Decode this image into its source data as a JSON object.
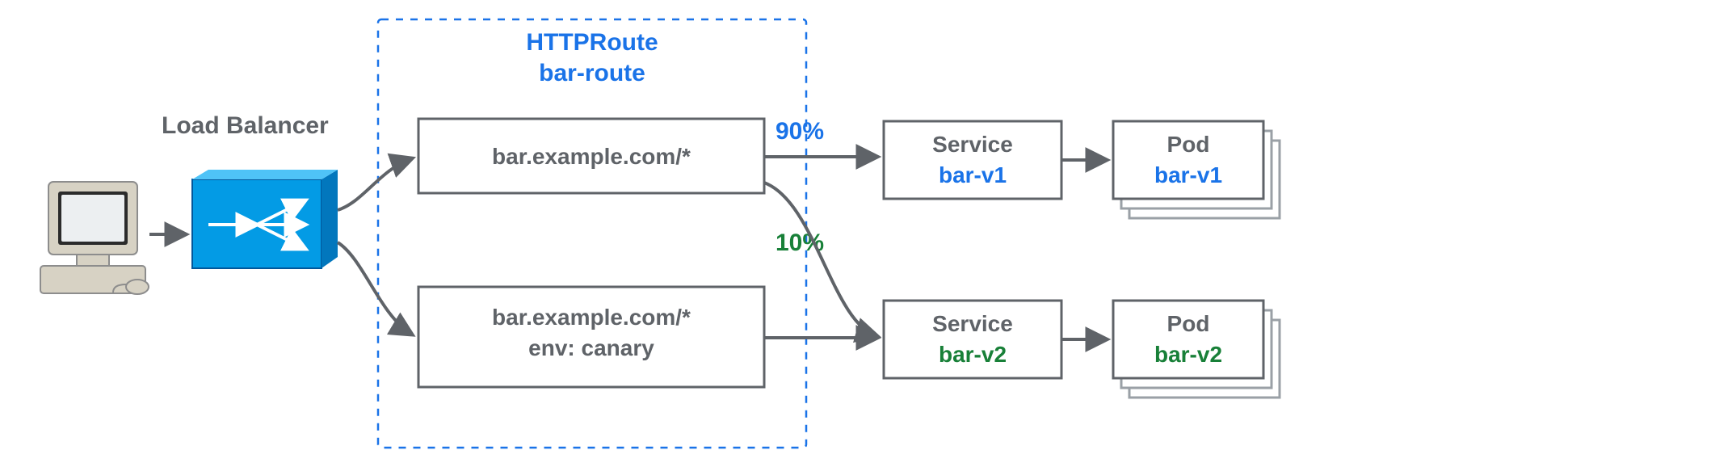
{
  "loadBalancer": {
    "title": "Load Balancer"
  },
  "httpRoute": {
    "title1": "HTTPRoute",
    "title2": "bar-route",
    "rules": {
      "a": {
        "line1": "bar.example.com/*"
      },
      "b": {
        "line1": "bar.example.com/*",
        "line2": "env: canary"
      }
    }
  },
  "weights": {
    "top": "90%",
    "mid": "10%"
  },
  "services": {
    "v1": {
      "label": "Service",
      "name": "bar-v1"
    },
    "v2": {
      "label": "Service",
      "name": "bar-v2"
    }
  },
  "pods": {
    "v1": {
      "label": "Pod",
      "name": "bar-v1"
    },
    "v2": {
      "label": "Pod",
      "name": "bar-v2"
    }
  },
  "colors": {
    "gray": "#5f6368",
    "blue": "#1a73e8",
    "green": "#188038",
    "lbFill": "#039be5",
    "pcBody": "#d7d2c4",
    "pcScreen": "#eceff1"
  }
}
